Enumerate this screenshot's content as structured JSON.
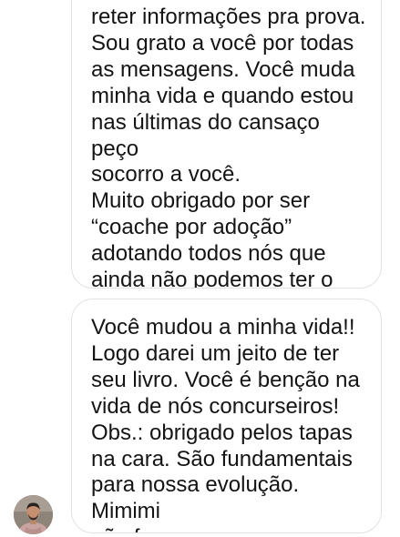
{
  "conversation": {
    "messages": [
      {
        "text": "reter informações pra prova.\nSou grato a você por todas\nas mensagens. Você muda\nminha vida e quando estou\nnas últimas do cansaço peço\nsocorro a você.\nMuito obrigado por ser\n“coache por adoção”\nadotando todos nós que\nainda não podemos ter o\nprivilégio de contrata-la."
      },
      {
        "text": "Você mudou a minha vida!!\nLogo darei um jeito de ter\nseu livro. Você é benção na\nvida de nós concurseiros!\nObs.: obrigado pelos tapas\nna cara. São fundamentais\npara nossa evolução. Mimimi\nnão faz ngm passar mesmo."
      }
    ],
    "sender_avatar": {
      "icon": "user-avatar-photo"
    }
  }
}
